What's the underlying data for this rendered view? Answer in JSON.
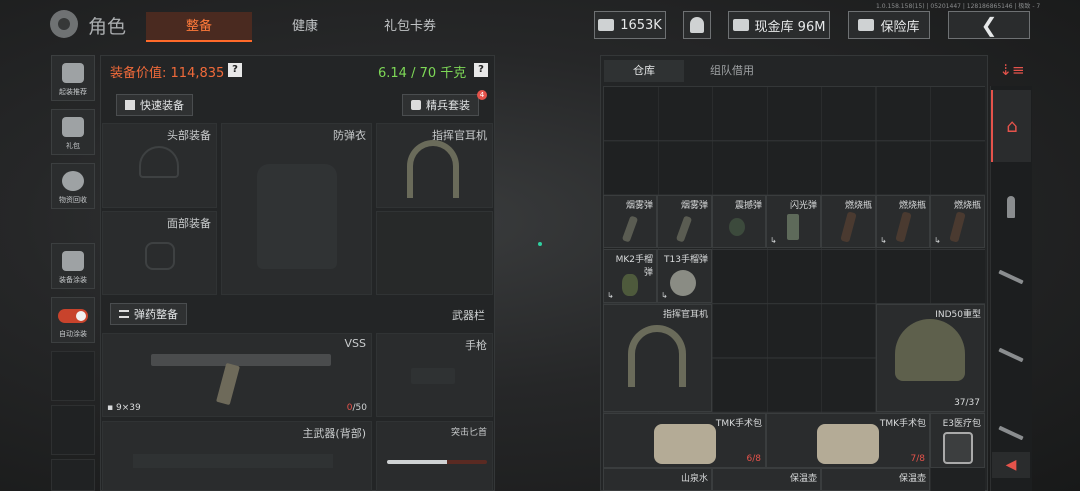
{
  "version_text": "1.0.158.158(15) | 05201447 | 128186865146 | 极致 - 7",
  "header": {
    "title": "角色",
    "tabs": [
      {
        "label": "整备",
        "active": true
      },
      {
        "label": "健康",
        "active": false
      },
      {
        "label": "礼包卡券",
        "active": false
      }
    ],
    "currency": "1653K",
    "cash_storage": "现金库 96M",
    "vault": "保险库"
  },
  "sidebar": [
    {
      "label": "起装推荐"
    },
    {
      "label": "礼包"
    },
    {
      "label": "物资回收"
    },
    {
      "label": "装备涂装"
    },
    {
      "label": "自动涂装"
    }
  ],
  "loadout": {
    "value_label": "装备价值:",
    "value": "114,835",
    "weight": "6.14 / 70 千克",
    "quick_equip": "快速装备",
    "elite_kit": "精兵套装",
    "elite_badge": "4",
    "slots": {
      "helmet": "头部装备",
      "armor": "防弹衣",
      "headset": "指挥官耳机",
      "face": "面部装备"
    },
    "ammo_btn": "弹药整备",
    "weapon_bar": "武器栏",
    "primary": {
      "name": "VSS",
      "ammo": "9×39",
      "mag_current": "0",
      "mag_max": "/50"
    },
    "pistol": "手枪",
    "main_weapon_back": "主武器(背部)",
    "melee": "突击匕首"
  },
  "storage": {
    "tabs": [
      {
        "label": "仓库",
        "active": true
      },
      {
        "label": "组队借用",
        "active": false
      }
    ],
    "items": [
      {
        "name": "烟雾弹"
      },
      {
        "name": "烟雾弹"
      },
      {
        "name": "震撼弹"
      },
      {
        "name": "闪光弹"
      },
      {
        "name": "燃烧瓶"
      },
      {
        "name": "燃烧瓶"
      },
      {
        "name": "燃烧瓶"
      },
      {
        "name": "MK2手榴弹"
      },
      {
        "name": "T13手榴弹"
      },
      {
        "name": "指挥官耳机"
      },
      {
        "name": "IND50重型",
        "count": "37/37"
      },
      {
        "name": "TMK手术包",
        "count": "6/8"
      },
      {
        "name": "TMK手术包",
        "count": "7/8"
      },
      {
        "name": "E3医疗包"
      },
      {
        "name": "山泉水"
      },
      {
        "name": "保温壶"
      },
      {
        "name": "保温壶"
      }
    ]
  }
}
